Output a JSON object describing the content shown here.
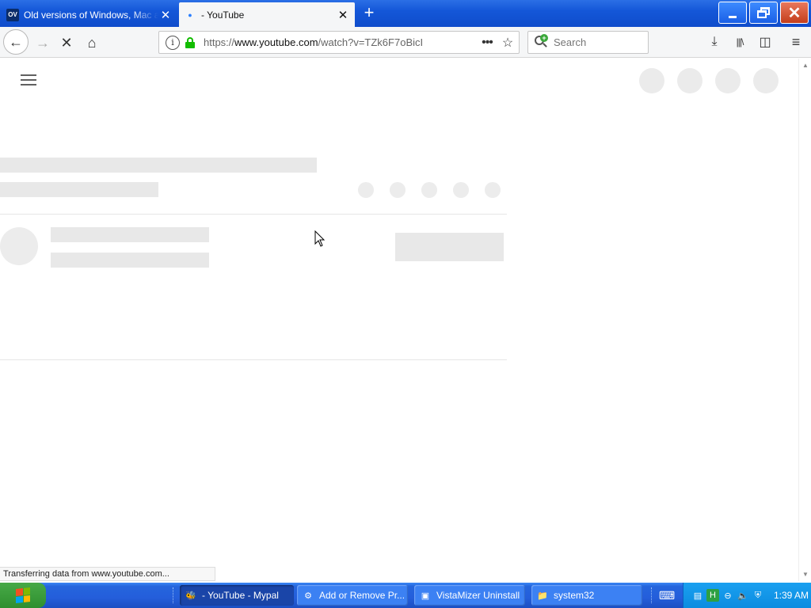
{
  "browser": {
    "tabs": [
      {
        "title": "Old versions of Windows, Mac and",
        "favicon": "OV",
        "close": "✕"
      },
      {
        "title": "- YouTube",
        "close": "✕"
      }
    ],
    "new_tab": "+",
    "window_buttons": {
      "minimize": "",
      "maximize": "",
      "close": "✕"
    },
    "nav": {
      "back": "←",
      "forward": "→",
      "stop": "✕",
      "home": "⌂"
    },
    "urlbar": {
      "info": "i",
      "scheme": "https://",
      "host": "www.youtube.com",
      "path": "/watch?v=TZk6F7oBicI",
      "more": "•••",
      "bookmark": "☆"
    },
    "search": {
      "placeholder": "Search"
    },
    "toolbar": {
      "downloads": "⤓",
      "library": "|||\\",
      "sidebar": "◫",
      "menu": "≡"
    },
    "status": "Transferring data from www.youtube.com..."
  },
  "taskbar": {
    "start_label": "",
    "buttons": [
      {
        "label": "- YouTube - Mypal",
        "icon": "🐝",
        "state": "active"
      },
      {
        "label": "Add or Remove Pr...",
        "icon": "⚙",
        "state": "normal"
      },
      {
        "label": "VistaMizer Uninstall",
        "icon": "▣",
        "state": "normal"
      },
      {
        "label": "system32",
        "icon": "📁",
        "state": "normal"
      }
    ],
    "clock": "1:39 AM"
  },
  "colors": {
    "accent": "#245edb",
    "skeleton": "#e8e8e8",
    "lock_green": "#12bc00"
  }
}
